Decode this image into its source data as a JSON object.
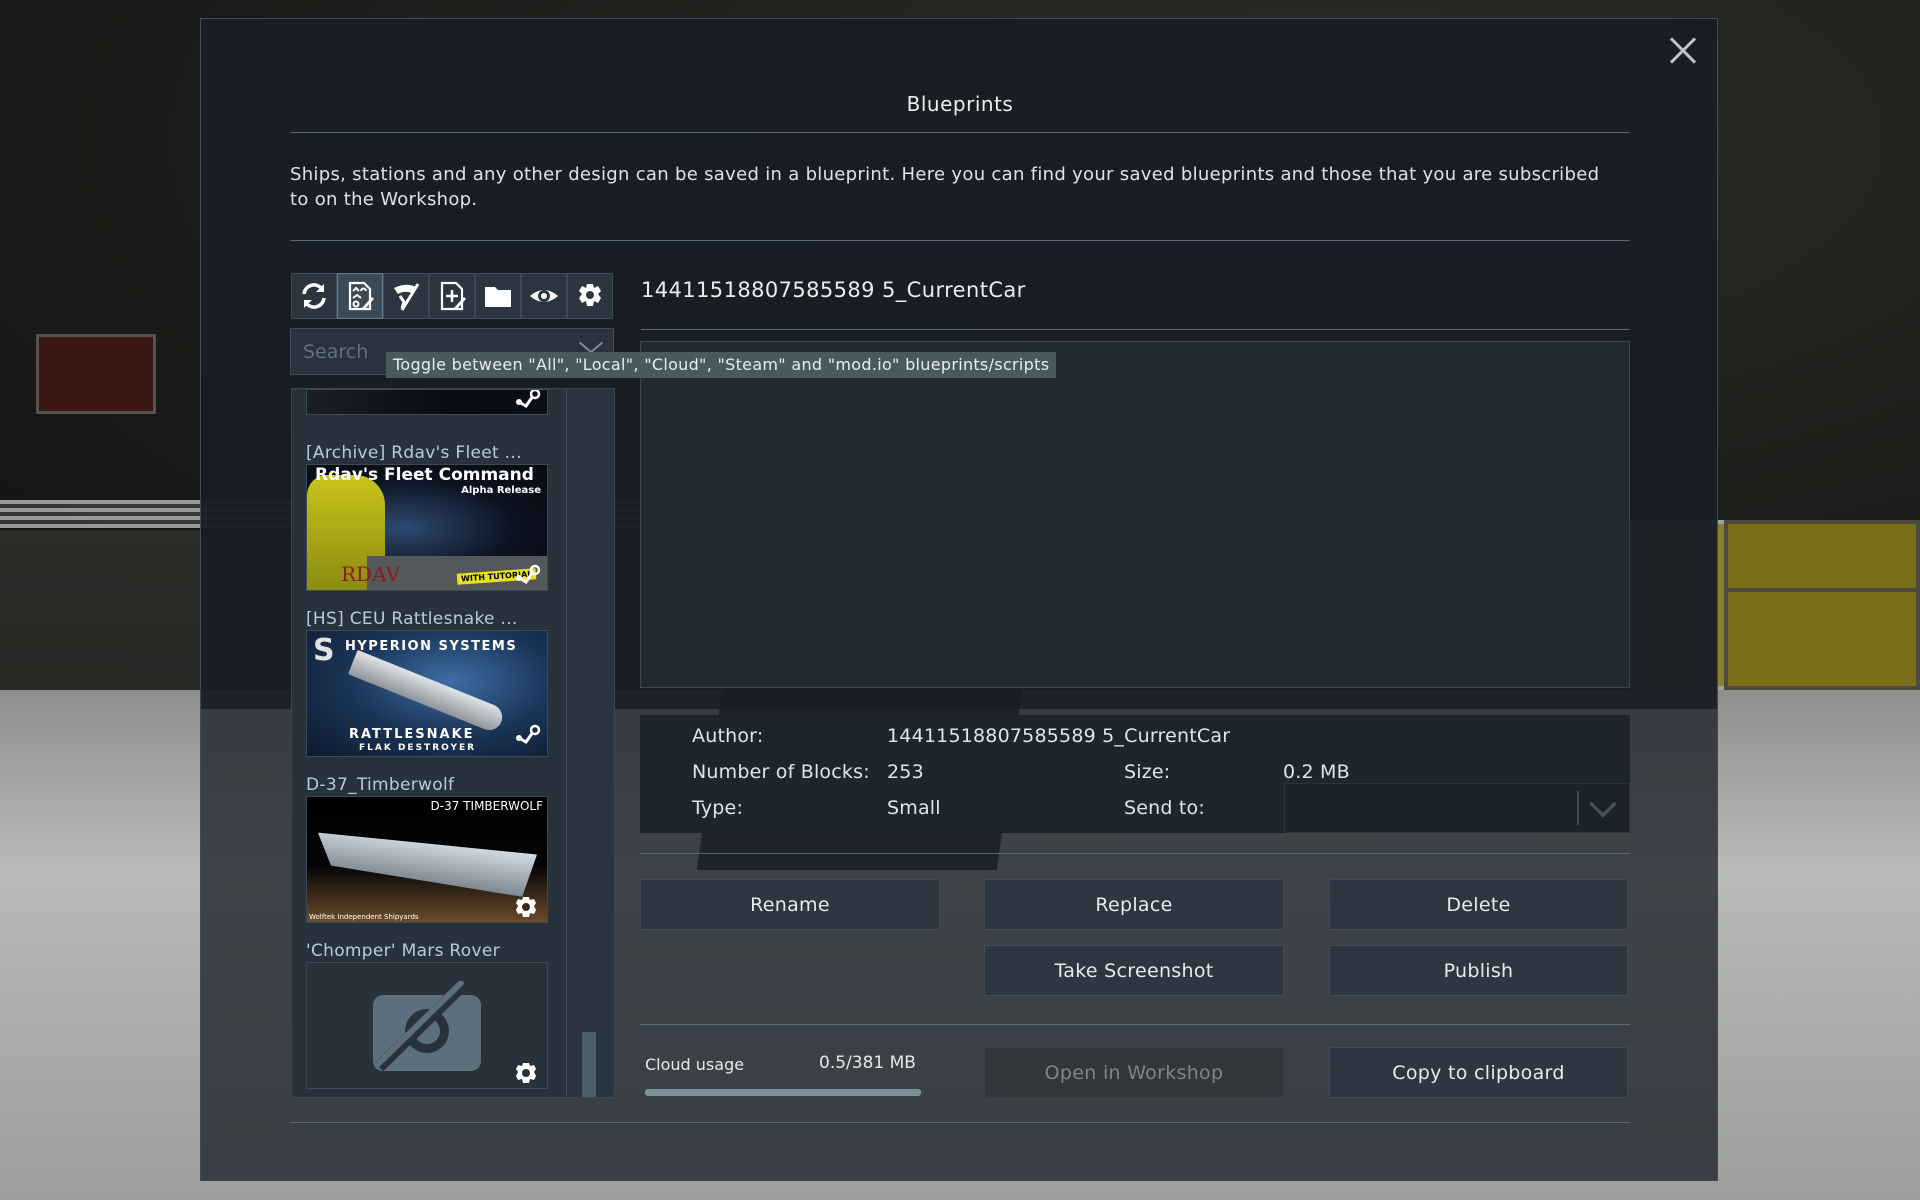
{
  "dialog": {
    "title": "Blueprints",
    "description": "Ships, stations and any other design can be saved in a blueprint. Here you can find your saved blueprints and those that you are subscribed to on the Workshop.",
    "close_icon": "close-x-icon"
  },
  "toolbar": {
    "buttons": [
      {
        "icon": "refresh-icon",
        "active": false
      },
      {
        "icon": "blueprint-filter-icon",
        "active": true
      },
      {
        "icon": "hide-icon",
        "active": false
      },
      {
        "icon": "new-blueprint-icon",
        "active": false
      },
      {
        "icon": "folder-icon",
        "active": false
      },
      {
        "icon": "eye-icon",
        "active": false
      },
      {
        "icon": "settings-gear-icon",
        "active": false
      }
    ]
  },
  "search": {
    "placeholder": "Search",
    "value": ""
  },
  "tooltip": {
    "text": "Toggle between \"All\", \"Local\", \"Cloud\", \"Steam\" and \"mod.io\" blueprints/scripts"
  },
  "list": {
    "items": [
      {
        "name": "",
        "source_icon": "steam-icon",
        "partial": true
      },
      {
        "name": "[Archive] Rdav's Fleet ...",
        "thumb_title": "Rdav's Fleet Command",
        "thumb_subtitle": "Alpha Release",
        "thumb_logo": "RDAV",
        "thumb_banner": "WITH TUTORIAL",
        "source_icon": "steam-icon"
      },
      {
        "name": "[HS] CEU Rattlesnake ...",
        "thumb_title": "HYPERION SYSTEMS",
        "thumb_subtitle": "RATTLESNAKE",
        "thumb_caption": "FLAK DESTROYER",
        "source_icon": "steam-icon"
      },
      {
        "name": "D-37_Timberwolf",
        "thumb_title": "D-37 TIMBERWOLF",
        "thumb_caption": "Wolftek Independent Shipyards",
        "source_icon": "modio-gear-icon"
      },
      {
        "name": "'Chomper' Mars Rover",
        "thumb_placeholder": "no-screenshot-icon",
        "source_icon": "modio-gear-icon"
      }
    ],
    "scroll_position": 0.91
  },
  "blueprint": {
    "name": "14411518807585589 5_CurrentCar",
    "description_value": "14411518807585589 5_CurrentCar"
  },
  "info": {
    "author_label": "Author:",
    "author_value": "14411518807585589 5_CurrentCar",
    "blocks_label": "Number of Blocks:",
    "blocks_value": "253",
    "size_label": "Size:",
    "size_value": "0.2 MB",
    "type_label": "Type:",
    "type_value": "Small",
    "sendto_label": "Send to:",
    "sendto_value": ""
  },
  "buttons": {
    "rename": "Rename",
    "replace": "Replace",
    "delete": "Delete",
    "take_screenshot": "Take Screenshot",
    "publish": "Publish",
    "open_workshop": "Open in Workshop",
    "copy_clipboard": "Copy to clipboard"
  },
  "cloud": {
    "label": "Cloud usage",
    "value": "0.5/381 MB",
    "fill_fraction": 0.99
  }
}
